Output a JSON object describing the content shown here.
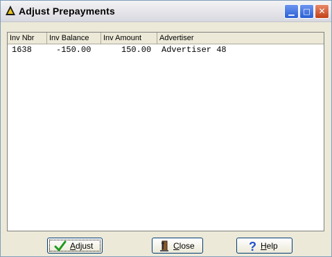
{
  "window": {
    "title": "Adjust Prepayments",
    "min_symbol": "▁",
    "max_symbol": "□",
    "close_symbol": "✕"
  },
  "list": {
    "columns": [
      "Inv Nbr",
      "Inv Balance",
      "Inv Amount",
      "Advertiser"
    ],
    "rows": [
      {
        "inv_nbr": "1638",
        "inv_balance": "-150.00",
        "inv_amount": "150.00",
        "advertiser": "Advertiser 48"
      }
    ]
  },
  "buttons": {
    "adjust": {
      "prefix": "",
      "hotkey": "A",
      "rest": "djust",
      "icon": "checkmark-icon"
    },
    "close": {
      "prefix": "",
      "hotkey": "C",
      "rest": "lose",
      "icon": "door-exit-icon"
    },
    "help": {
      "prefix": "",
      "hotkey": "H",
      "rest": "elp",
      "icon": "question-mark-icon"
    }
  },
  "colors": {
    "accent": "#2a5fd4",
    "check_green": "#1e9a1e",
    "help_blue": "#1f4fd0"
  }
}
